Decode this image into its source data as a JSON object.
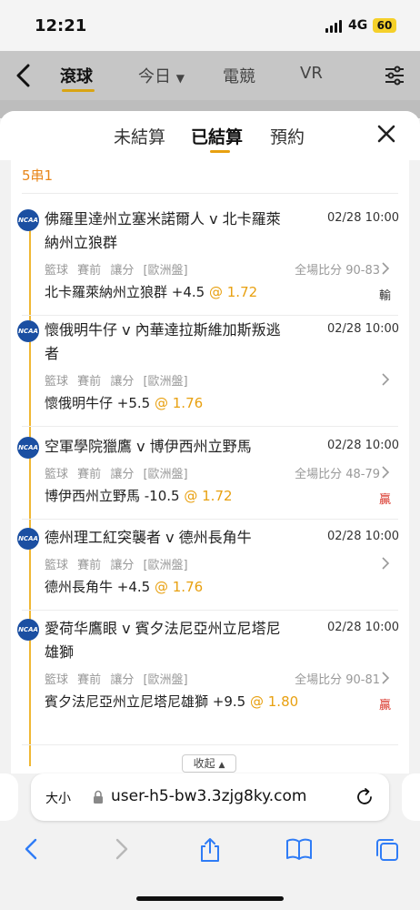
{
  "status_bar": {
    "time": "12:21",
    "network": "4G",
    "battery": "60"
  },
  "app_header": {
    "tabs": [
      {
        "label": "滾球"
      },
      {
        "label": "今日"
      },
      {
        "label": "電競"
      },
      {
        "label": "VR"
      }
    ]
  },
  "sheet": {
    "tabs": [
      {
        "label": "未結算"
      },
      {
        "label": "已結算"
      },
      {
        "label": "預約"
      }
    ],
    "combo_label": "5串1",
    "collapse_label": "收起",
    "legs": [
      {
        "match": "佛羅里達州立塞米諾爾人 v 北卡羅萊納州立狼群",
        "date": "02/28 10:00",
        "sport": "籃球",
        "stage": "賽前",
        "bet_type": "讓分",
        "odds_format": "[歐洲盤]",
        "score": "全場比分 90-83",
        "pick": "北卡羅萊納州立狼群 +4.5",
        "odds": "@ 1.72",
        "result": "輸"
      },
      {
        "match": "懷俄明牛仔 v 內華達拉斯維加斯叛逃者",
        "date": "02/28 10:00",
        "sport": "籃球",
        "stage": "賽前",
        "bet_type": "讓分",
        "odds_format": "[歐洲盤]",
        "score": "",
        "pick": "懷俄明牛仔 +5.5",
        "odds": "@ 1.76",
        "result": ""
      },
      {
        "match": "空軍學院獵鷹 v 博伊西州立野馬",
        "date": "02/28 10:00",
        "sport": "籃球",
        "stage": "賽前",
        "bet_type": "讓分",
        "odds_format": "[歐洲盤]",
        "score": "全場比分 48-79",
        "pick": "博伊西州立野馬 -10.5",
        "odds": "@ 1.72",
        "result": "贏"
      },
      {
        "match": "德州理工紅突襲者 v 德州長角牛",
        "date": "02/28 10:00",
        "sport": "籃球",
        "stage": "賽前",
        "bet_type": "讓分",
        "odds_format": "[歐洲盤]",
        "score": "",
        "pick": "德州長角牛 +4.5",
        "odds": "@ 1.76",
        "result": ""
      },
      {
        "match": "愛荷华鷹眼 v 賓夕法尼亞州立尼塔尼雄獅",
        "date": "02/28 10:00",
        "sport": "籃球",
        "stage": "賽前",
        "bet_type": "讓分",
        "odds_format": "[歐洲盤]",
        "score": "全場比分 90-81",
        "pick": "賓夕法尼亞州立尼塔尼雄獅 +9.5",
        "odds": "@ 1.80",
        "result": "贏"
      }
    ]
  },
  "league_logo_text": "NCAA",
  "browser": {
    "text_size_label": "大小",
    "url": "user-h5-bw3.3zjg8ky.com"
  },
  "colors": {
    "accent": "#e8a010",
    "combo": "#e8861a",
    "win": "#d9362b",
    "loss": "#333333",
    "ncaa_logo": "#1b4fa2"
  }
}
